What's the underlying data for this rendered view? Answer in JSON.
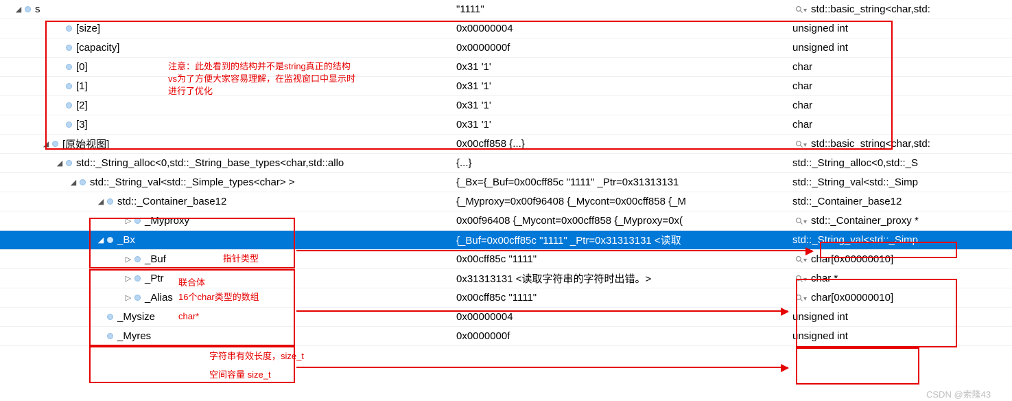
{
  "rows": [
    {
      "indent": 20,
      "exp": "open",
      "name": "s",
      "value": "\"1111\"",
      "type": "std::basic_string<char,std:",
      "mag": true
    },
    {
      "indent": 80,
      "exp": "none",
      "name": "[size]",
      "value": "0x00000004",
      "type": "unsigned int"
    },
    {
      "indent": 80,
      "exp": "none",
      "name": "[capacity]",
      "value": "0x0000000f",
      "type": "unsigned int"
    },
    {
      "indent": 80,
      "exp": "none",
      "name": "[0]",
      "value": "0x31 '1'",
      "type": "char"
    },
    {
      "indent": 80,
      "exp": "none",
      "name": "[1]",
      "value": "0x31 '1'",
      "type": "char"
    },
    {
      "indent": 80,
      "exp": "none",
      "name": "[2]",
      "value": "0x31 '1'",
      "type": "char"
    },
    {
      "indent": 80,
      "exp": "none",
      "name": "[3]",
      "value": "0x31 '1'",
      "type": "char"
    },
    {
      "indent": 60,
      "exp": "open",
      "name": "[原始视图]",
      "value": "0x00cff858 {...}",
      "type": "std::basic_string<char,std:",
      "mag": true
    },
    {
      "indent": 80,
      "exp": "open",
      "name": "std::_String_alloc<0,std::_String_base_types<char,std::allo",
      "value": "{...}",
      "type": "std::_String_alloc<0,std::_S"
    },
    {
      "indent": 100,
      "exp": "open",
      "name": "std::_String_val<std::_Simple_types<char> >",
      "value": "{_Bx={_Buf=0x00cff85c \"1111\" _Ptr=0x31313131",
      "type": "std::_String_val<std::_Simp"
    },
    {
      "indent": 140,
      "exp": "open",
      "name": "std::_Container_base12",
      "value": "{_Myproxy=0x00f96408 {_Mycont=0x00cff858 {_M",
      "type": "std::_Container_base12"
    },
    {
      "indent": 180,
      "exp": "closed",
      "name": "_Myproxy",
      "value": "0x00f96408 {_Mycont=0x00cff858 {_Myproxy=0x(",
      "type": "std::_Container_proxy *",
      "mag": true
    },
    {
      "indent": 140,
      "exp": "open",
      "name": "_Bx",
      "value": "{_Buf=0x00cff85c \"1111\" _Ptr=0x31313131 <读取",
      "type": "std::_String_val<std::_Simp",
      "selected": true
    },
    {
      "indent": 180,
      "exp": "closed",
      "name": "_Buf",
      "value": "0x00cff85c \"1111\"",
      "type": "char[0x00000010]",
      "mag": true
    },
    {
      "indent": 180,
      "exp": "closed",
      "name": "_Ptr",
      "value": "0x31313131 <读取字符串的字符时出错。>",
      "type": "char *",
      "mag": true
    },
    {
      "indent": 180,
      "exp": "closed",
      "name": "_Alias",
      "value": "0x00cff85c \"1111\"",
      "type": "char[0x00000010]",
      "mag": true
    },
    {
      "indent": 140,
      "exp": "none",
      "name": "_Mysize",
      "value": "0x00000004",
      "type": "unsigned int"
    },
    {
      "indent": 140,
      "exp": "none",
      "name": "_Myres",
      "value": "0x0000000f",
      "type": "unsigned int"
    }
  ],
  "annotations": {
    "note1_line1": "注意：此处看到的结构并不是string真正的结构",
    "note1_line2": "vs为了方便大家容易理解，在监视窗口中显示时",
    "note1_line3": "进行了优化",
    "myproxy": "指针类型",
    "bx": "联合体",
    "buf": "16个char类型的数组",
    "ptr": "char*",
    "mysize": "字符串有效长度，size_t",
    "myres": "空间容量  size_t"
  },
  "watermark": "CSDN @索隆43"
}
